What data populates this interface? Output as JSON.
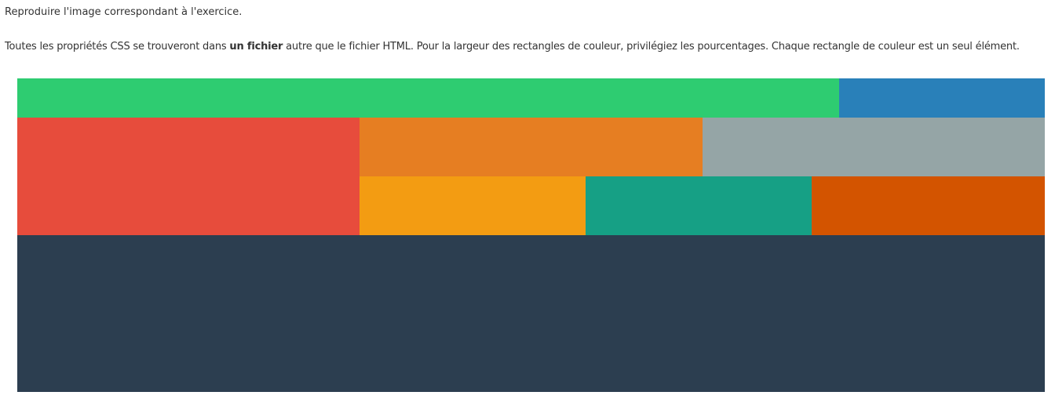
{
  "intro_text": "Reproduire l'image correspondant à l'exercice.",
  "instructions": {
    "before_bold": "Toutes les propriétés CSS se trouveront dans ",
    "bold": "un fichier",
    "after_bold": " autre que le fichier HTML. Pour la largeur des rectangles de couleur, privilégiez les pourcentages. Chaque rectangle de couleur est un seul élément."
  },
  "rectangles": [
    {
      "id": "top-left",
      "color": "#2ecc71"
    },
    {
      "id": "top-right",
      "color": "#2980b9"
    },
    {
      "id": "mid-left",
      "color": "#e74c3c"
    },
    {
      "id": "mid-a",
      "color": "#e67e22"
    },
    {
      "id": "mid-b",
      "color": "#95a5a6"
    },
    {
      "id": "low-a",
      "color": "#f39c12"
    },
    {
      "id": "low-b",
      "color": "#16a085"
    },
    {
      "id": "low-c",
      "color": "#d35400"
    },
    {
      "id": "bottom",
      "color": "#2c3e50"
    }
  ]
}
